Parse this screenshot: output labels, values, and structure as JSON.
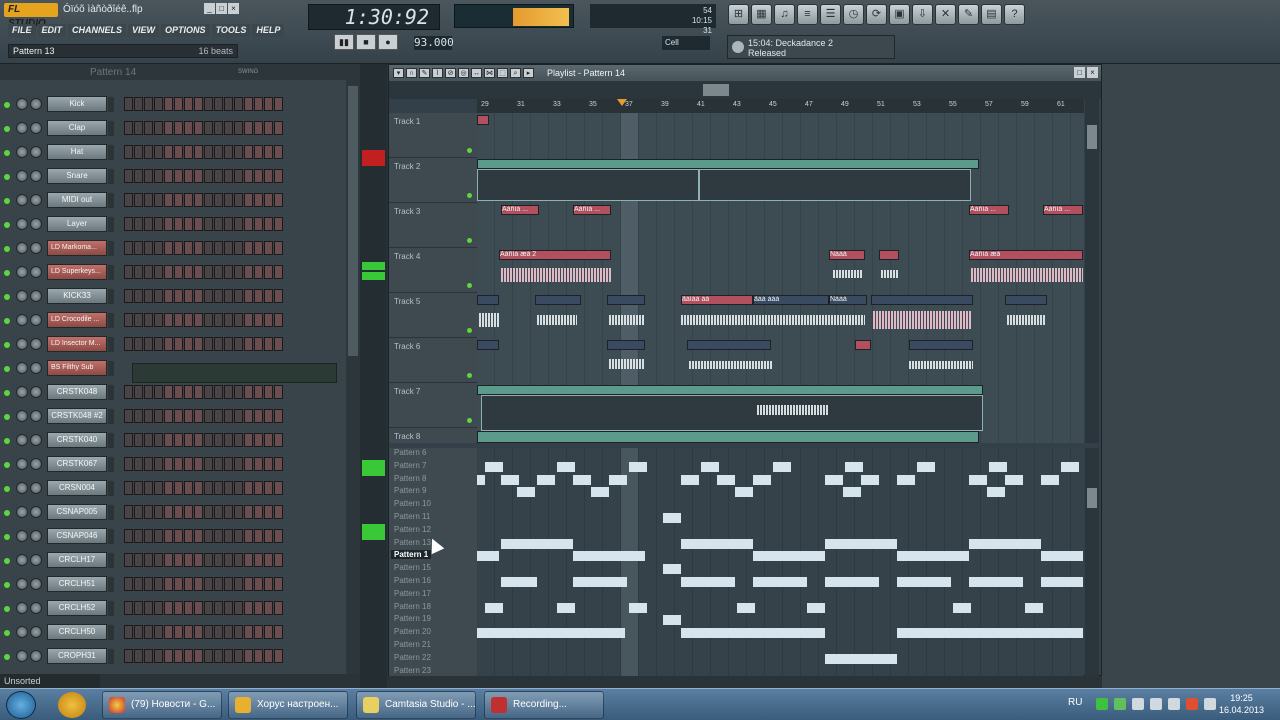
{
  "app": {
    "logo": "FL STUDIO",
    "title": "Óïóõ ìàñòðîéê..flp",
    "window_buttons": [
      "_",
      "□",
      "×"
    ]
  },
  "menu": [
    "FILE",
    "EDIT",
    "CHANNELS",
    "VIEW",
    "OPTIONS",
    "TOOLS",
    "HELP"
  ],
  "pattern_box": {
    "name": "Pattern 13",
    "beats": "16 beats"
  },
  "transport": {
    "time": "1:30:92",
    "tempo": "93.000",
    "buttons": [
      "▮▮",
      "■",
      "●"
    ],
    "snap": "Cell"
  },
  "cpu": {
    "label": "",
    "vals": [
      "54",
      "10:15",
      "31"
    ]
  },
  "hint": {
    "line1": "15:04: Deckadance 2",
    "line2": "Released"
  },
  "toolbar_icons": [
    "mixer-icon",
    "channels-icon",
    "piano-icon",
    "browser-icon",
    "playlist-icon",
    "tempo-icon",
    "cpu-icon",
    "save-icon",
    "render-icon",
    "plugin-icon",
    "help-icon",
    "settings-icon",
    "info-icon"
  ],
  "rack": {
    "header_pattern": "Pattern 14",
    "swing_label": "SWING",
    "channels": [
      {
        "name": "Kick",
        "red": false
      },
      {
        "name": "Clap",
        "red": false
      },
      {
        "name": "Hat",
        "red": false
      },
      {
        "name": "Snare",
        "red": false
      },
      {
        "name": "MIDI out",
        "red": false
      },
      {
        "name": "Layer",
        "red": false
      },
      {
        "name": "LD Markoma...",
        "red": true
      },
      {
        "name": "LD Superkeys...",
        "red": true
      },
      {
        "name": "KICK33",
        "red": false
      },
      {
        "name": "LD Crocodile ...",
        "red": true
      },
      {
        "name": "LD Insector M...",
        "red": true
      },
      {
        "name": "BS Filthy Sub",
        "red": true
      },
      {
        "name": "CRSTK048",
        "red": false
      },
      {
        "name": "CRSTK048 #2",
        "red": false
      },
      {
        "name": "CRSTK040",
        "red": false
      },
      {
        "name": "CRSTK067",
        "red": false
      },
      {
        "name": "CRSN004",
        "red": false
      },
      {
        "name": "CSNAP005",
        "red": false
      },
      {
        "name": "CSNAP046",
        "red": false
      },
      {
        "name": "CRCLH17",
        "red": false
      },
      {
        "name": "CRCLH51",
        "red": false
      },
      {
        "name": "CRCLH52",
        "red": false
      },
      {
        "name": "CRCLH50",
        "red": false
      },
      {
        "name": "CROPH31",
        "red": false
      }
    ],
    "status": "Unsorted"
  },
  "playlist": {
    "title": "Playlist - Pattern 14",
    "ruler": [
      "29",
      "31",
      "33",
      "35",
      "37",
      "39",
      "41",
      "43",
      "45",
      "47",
      "49",
      "51",
      "53",
      "55",
      "57",
      "59",
      "61"
    ],
    "tracks": [
      "Track 1",
      "Track 2",
      "Track 3",
      "Track 4",
      "Track 5",
      "Track 6",
      "Track 7",
      "Track 8"
    ],
    "clip_labels": {
      "t3a": "Äåñìà ...",
      "t3b": "Äåñìà ...",
      "t3c": "Äåñìà ...",
      "t3d": "Äåñìà ...",
      "t4a": "Äåñìà æå 2",
      "t4b": "Äåñìà æå",
      "t4c": "Ñåàå",
      "t4d": "Äåñìà æå",
      "t5a": "ãàìàå àå",
      "t5b": "ãàà àåà",
      "t5c": "Ñåàå"
    },
    "patterns": [
      "Pattern 6",
      "Pattern 7",
      "Pattern 8",
      "Pattern 9",
      "Pattern 10",
      "Pattern 11",
      "Pattern 12",
      "Pattern 13",
      "Pattern 14",
      "Pattern 15",
      "Pattern 16",
      "Pattern 17",
      "Pattern 18",
      "Pattern 19",
      "Pattern 20",
      "Pattern 21",
      "Pattern 22",
      "Pattern 23"
    ],
    "current_pattern_index": 8,
    "current_pattern_label": "Pattern 1"
  },
  "taskbar": {
    "items": [
      "(79) Новости - G...",
      "Хорус настроен...",
      "Camtasia Studio - ...",
      "Recording..."
    ],
    "lang": "RU",
    "time": "19:25",
    "date": "16.04.2013"
  }
}
